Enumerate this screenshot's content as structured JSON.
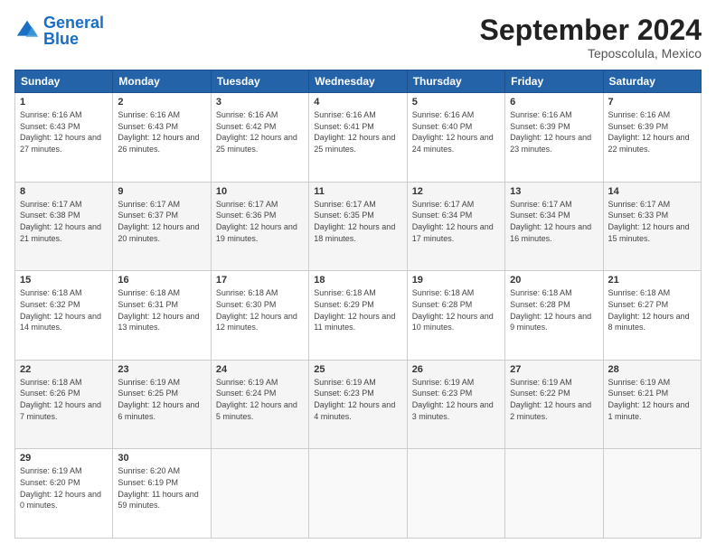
{
  "header": {
    "logo_general": "General",
    "logo_blue": "Blue",
    "title": "September 2024",
    "location": "Teposcolula, Mexico"
  },
  "columns": [
    "Sunday",
    "Monday",
    "Tuesday",
    "Wednesday",
    "Thursday",
    "Friday",
    "Saturday"
  ],
  "weeks": [
    [
      {
        "day": "1",
        "sunrise": "Sunrise: 6:16 AM",
        "sunset": "Sunset: 6:43 PM",
        "daylight": "Daylight: 12 hours and 27 minutes."
      },
      {
        "day": "2",
        "sunrise": "Sunrise: 6:16 AM",
        "sunset": "Sunset: 6:43 PM",
        "daylight": "Daylight: 12 hours and 26 minutes."
      },
      {
        "day": "3",
        "sunrise": "Sunrise: 6:16 AM",
        "sunset": "Sunset: 6:42 PM",
        "daylight": "Daylight: 12 hours and 25 minutes."
      },
      {
        "day": "4",
        "sunrise": "Sunrise: 6:16 AM",
        "sunset": "Sunset: 6:41 PM",
        "daylight": "Daylight: 12 hours and 25 minutes."
      },
      {
        "day": "5",
        "sunrise": "Sunrise: 6:16 AM",
        "sunset": "Sunset: 6:40 PM",
        "daylight": "Daylight: 12 hours and 24 minutes."
      },
      {
        "day": "6",
        "sunrise": "Sunrise: 6:16 AM",
        "sunset": "Sunset: 6:39 PM",
        "daylight": "Daylight: 12 hours and 23 minutes."
      },
      {
        "day": "7",
        "sunrise": "Sunrise: 6:16 AM",
        "sunset": "Sunset: 6:39 PM",
        "daylight": "Daylight: 12 hours and 22 minutes."
      }
    ],
    [
      {
        "day": "8",
        "sunrise": "Sunrise: 6:17 AM",
        "sunset": "Sunset: 6:38 PM",
        "daylight": "Daylight: 12 hours and 21 minutes."
      },
      {
        "day": "9",
        "sunrise": "Sunrise: 6:17 AM",
        "sunset": "Sunset: 6:37 PM",
        "daylight": "Daylight: 12 hours and 20 minutes."
      },
      {
        "day": "10",
        "sunrise": "Sunrise: 6:17 AM",
        "sunset": "Sunset: 6:36 PM",
        "daylight": "Daylight: 12 hours and 19 minutes."
      },
      {
        "day": "11",
        "sunrise": "Sunrise: 6:17 AM",
        "sunset": "Sunset: 6:35 PM",
        "daylight": "Daylight: 12 hours and 18 minutes."
      },
      {
        "day": "12",
        "sunrise": "Sunrise: 6:17 AM",
        "sunset": "Sunset: 6:34 PM",
        "daylight": "Daylight: 12 hours and 17 minutes."
      },
      {
        "day": "13",
        "sunrise": "Sunrise: 6:17 AM",
        "sunset": "Sunset: 6:34 PM",
        "daylight": "Daylight: 12 hours and 16 minutes."
      },
      {
        "day": "14",
        "sunrise": "Sunrise: 6:17 AM",
        "sunset": "Sunset: 6:33 PM",
        "daylight": "Daylight: 12 hours and 15 minutes."
      }
    ],
    [
      {
        "day": "15",
        "sunrise": "Sunrise: 6:18 AM",
        "sunset": "Sunset: 6:32 PM",
        "daylight": "Daylight: 12 hours and 14 minutes."
      },
      {
        "day": "16",
        "sunrise": "Sunrise: 6:18 AM",
        "sunset": "Sunset: 6:31 PM",
        "daylight": "Daylight: 12 hours and 13 minutes."
      },
      {
        "day": "17",
        "sunrise": "Sunrise: 6:18 AM",
        "sunset": "Sunset: 6:30 PM",
        "daylight": "Daylight: 12 hours and 12 minutes."
      },
      {
        "day": "18",
        "sunrise": "Sunrise: 6:18 AM",
        "sunset": "Sunset: 6:29 PM",
        "daylight": "Daylight: 12 hours and 11 minutes."
      },
      {
        "day": "19",
        "sunrise": "Sunrise: 6:18 AM",
        "sunset": "Sunset: 6:28 PM",
        "daylight": "Daylight: 12 hours and 10 minutes."
      },
      {
        "day": "20",
        "sunrise": "Sunrise: 6:18 AM",
        "sunset": "Sunset: 6:28 PM",
        "daylight": "Daylight: 12 hours and 9 minutes."
      },
      {
        "day": "21",
        "sunrise": "Sunrise: 6:18 AM",
        "sunset": "Sunset: 6:27 PM",
        "daylight": "Daylight: 12 hours and 8 minutes."
      }
    ],
    [
      {
        "day": "22",
        "sunrise": "Sunrise: 6:18 AM",
        "sunset": "Sunset: 6:26 PM",
        "daylight": "Daylight: 12 hours and 7 minutes."
      },
      {
        "day": "23",
        "sunrise": "Sunrise: 6:19 AM",
        "sunset": "Sunset: 6:25 PM",
        "daylight": "Daylight: 12 hours and 6 minutes."
      },
      {
        "day": "24",
        "sunrise": "Sunrise: 6:19 AM",
        "sunset": "Sunset: 6:24 PM",
        "daylight": "Daylight: 12 hours and 5 minutes."
      },
      {
        "day": "25",
        "sunrise": "Sunrise: 6:19 AM",
        "sunset": "Sunset: 6:23 PM",
        "daylight": "Daylight: 12 hours and 4 minutes."
      },
      {
        "day": "26",
        "sunrise": "Sunrise: 6:19 AM",
        "sunset": "Sunset: 6:23 PM",
        "daylight": "Daylight: 12 hours and 3 minutes."
      },
      {
        "day": "27",
        "sunrise": "Sunrise: 6:19 AM",
        "sunset": "Sunset: 6:22 PM",
        "daylight": "Daylight: 12 hours and 2 minutes."
      },
      {
        "day": "28",
        "sunrise": "Sunrise: 6:19 AM",
        "sunset": "Sunset: 6:21 PM",
        "daylight": "Daylight: 12 hours and 1 minute."
      }
    ],
    [
      {
        "day": "29",
        "sunrise": "Sunrise: 6:19 AM",
        "sunset": "Sunset: 6:20 PM",
        "daylight": "Daylight: 12 hours and 0 minutes."
      },
      {
        "day": "30",
        "sunrise": "Sunrise: 6:20 AM",
        "sunset": "Sunset: 6:19 PM",
        "daylight": "Daylight: 11 hours and 59 minutes."
      },
      null,
      null,
      null,
      null,
      null
    ]
  ]
}
